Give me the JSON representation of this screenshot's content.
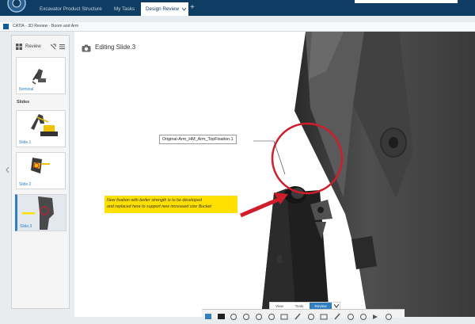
{
  "topbar": {
    "tabs": [
      "Excavator Product Structure",
      "My Tasks",
      "Design Review"
    ],
    "active_tab_chevron": "chevron-down-icon",
    "add_tab": "+"
  },
  "window": {
    "title": "CATIA - 3D Review - Boom and Arm"
  },
  "left_panel": {
    "header_label": "Review",
    "nominal_label": "Nominal",
    "slides_heading": "Slides",
    "slides": [
      {
        "label": "Slide.1"
      },
      {
        "label": "Slide.2"
      },
      {
        "label": "Slide.3"
      }
    ]
  },
  "viewport": {
    "editing_label": "Editing Slide.3",
    "callout_label": "Original-Arm_HM_Arm_TopFixation.1",
    "note_line1": "New fixation  with better strength is to be developed",
    "note_line2": "and replaced here to support new increased size Bucket",
    "colors": {
      "note_bg": "#ffe000",
      "annotation_red": "#d01d2c"
    }
  },
  "bottom_tabs": [
    "View",
    "Tools",
    "Review"
  ],
  "toolbar": {
    "icons": [
      "select-icon",
      "snapshot-icon",
      "rotate-icon",
      "section-icon",
      "measure-icon",
      "annotation-icon",
      "markup-icon",
      "pencil-icon",
      "camera-icon",
      "compare-icon",
      "slide-icon",
      "highlight-icon",
      "clash-icon",
      "play-icon",
      "record-icon"
    ]
  }
}
